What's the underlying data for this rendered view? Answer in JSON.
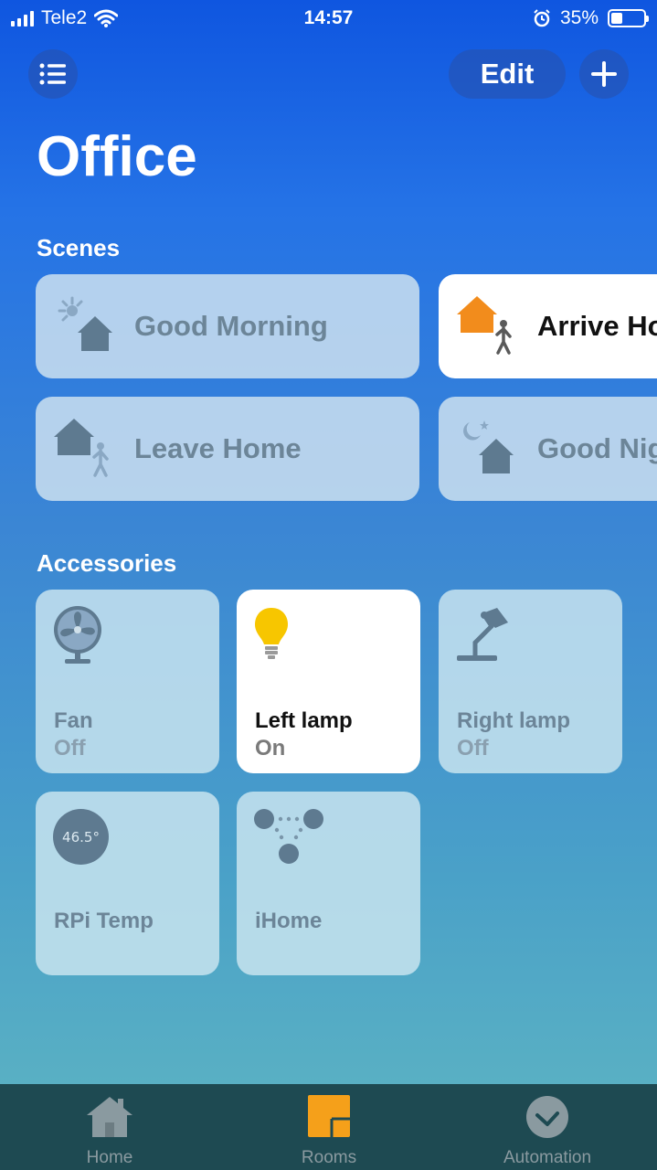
{
  "status_bar": {
    "carrier": "Tele2",
    "time": "14:57",
    "battery_percent": "35%",
    "battery_level": 0.35
  },
  "header": {
    "edit_label": "Edit",
    "room_title": "Office"
  },
  "scenes": {
    "section_title": "Scenes",
    "items": [
      {
        "label": "Good Morning",
        "icon": "good-morning-icon",
        "active": false
      },
      {
        "label": "Arrive Home",
        "icon": "arrive-home-icon",
        "active": true
      },
      {
        "label": "Leave Home",
        "icon": "leave-home-icon",
        "active": false
      },
      {
        "label": "Good Night",
        "icon": "good-night-icon",
        "active": false
      }
    ]
  },
  "accessories": {
    "section_title": "Accessories",
    "items": [
      {
        "name": "Fan",
        "state": "Off",
        "icon": "fan-icon",
        "active": false
      },
      {
        "name": "Left lamp",
        "state": "On",
        "icon": "lightbulb-icon",
        "active": true
      },
      {
        "name": "Right lamp",
        "state": "Off",
        "icon": "desk-lamp-icon",
        "active": false
      },
      {
        "name": "RPi Temp",
        "reading": "46.5°",
        "icon": "thermometer-icon",
        "active": false
      },
      {
        "name": "iHome",
        "icon": "bridge-icon",
        "active": false
      }
    ]
  },
  "tab_bar": {
    "tabs": [
      {
        "label": "Home",
        "icon": "home-icon",
        "active": false
      },
      {
        "label": "Rooms",
        "icon": "rooms-icon",
        "active": true
      },
      {
        "label": "Automation",
        "icon": "automation-icon",
        "active": false
      }
    ]
  },
  "colors": {
    "accent": "#f5a01a",
    "bulb_on": "#f7c600",
    "tab_bar": "#1e4a52",
    "inactive_text": "#6c8598"
  }
}
